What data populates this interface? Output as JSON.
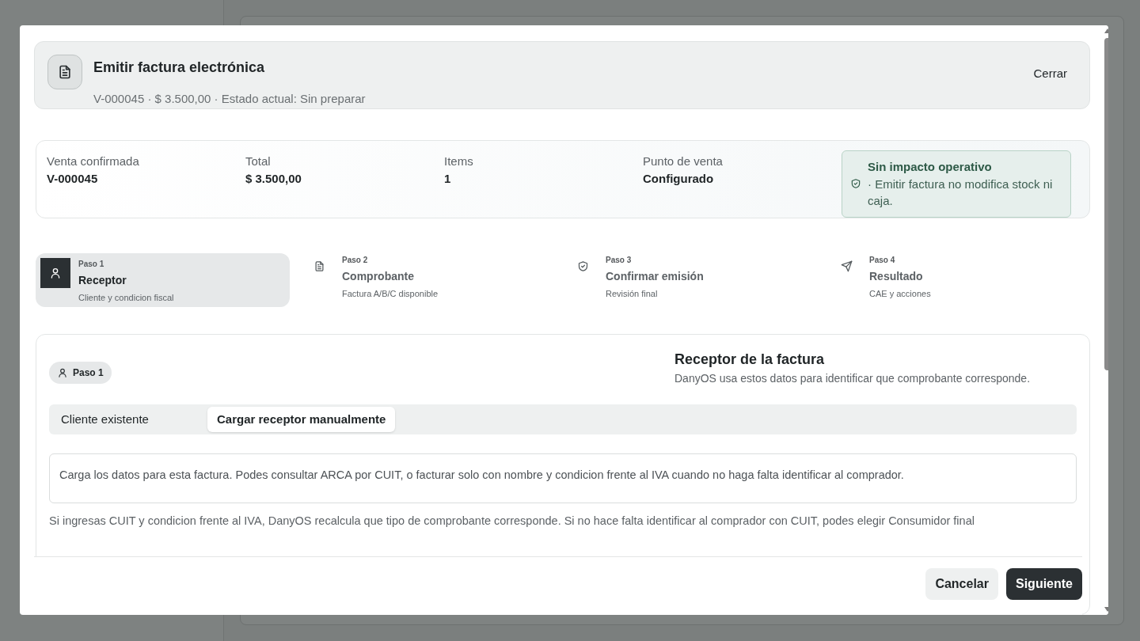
{
  "dialog": {
    "title": "Emitir factura electrónica",
    "subtitle": "V-000045 · $ 3.500,00 · Estado actual: Sin preparar",
    "close_label": "Cerrar"
  },
  "summary": {
    "items": [
      {
        "label": "Venta confirmada",
        "value": "V-000045"
      },
      {
        "label": "Total",
        "value": "$ 3.500,00"
      },
      {
        "label": "Items",
        "value": "1"
      },
      {
        "label": "Punto de venta",
        "value": "Configurado"
      }
    ],
    "notice": {
      "title": "Sin impacto operativo",
      "text": "· Emitir factura no modifica stock ni caja."
    }
  },
  "steps": [
    {
      "step": "Paso 1",
      "title": "Receptor",
      "subtitle": "Cliente y condicion fiscal",
      "selected": true
    },
    {
      "step": "Paso 2",
      "title": "Comprobante",
      "subtitle": "Factura A/B/C disponible",
      "selected": false
    },
    {
      "step": "Paso 3",
      "title": "Confirmar emisión",
      "subtitle": "Revisión final",
      "selected": false
    },
    {
      "step": "Paso 4",
      "title": "Resultado",
      "subtitle": "CAE y acciones",
      "selected": false
    }
  ],
  "panel": {
    "badge": "Paso 1",
    "title": "Receptor de la factura",
    "description": "DanyOS usa estos datos para identificar que comprobante corresponde.",
    "tabs": [
      {
        "label": "Cliente existente",
        "selected": false
      },
      {
        "label": "Cargar receptor manualmente",
        "selected": true
      }
    ],
    "info": "Carga los datos para esta factura. Podes consultar ARCA por CUIT, o facturar solo con nombre y condicion frente al IVA cuando no haga falta identificar al comprador.",
    "help": "Si ingresas CUIT y condicion frente al IVA, DanyOS recalcula que tipo de comprobante corresponde. Si no hace falta identificar al comprador con CUIT, podes elegir Consumidor final"
  },
  "footer": {
    "buttons": [
      {
        "label": "Cancelar",
        "kind": "secondary"
      },
      {
        "label": "Siguiente",
        "kind": "primary"
      }
    ]
  }
}
